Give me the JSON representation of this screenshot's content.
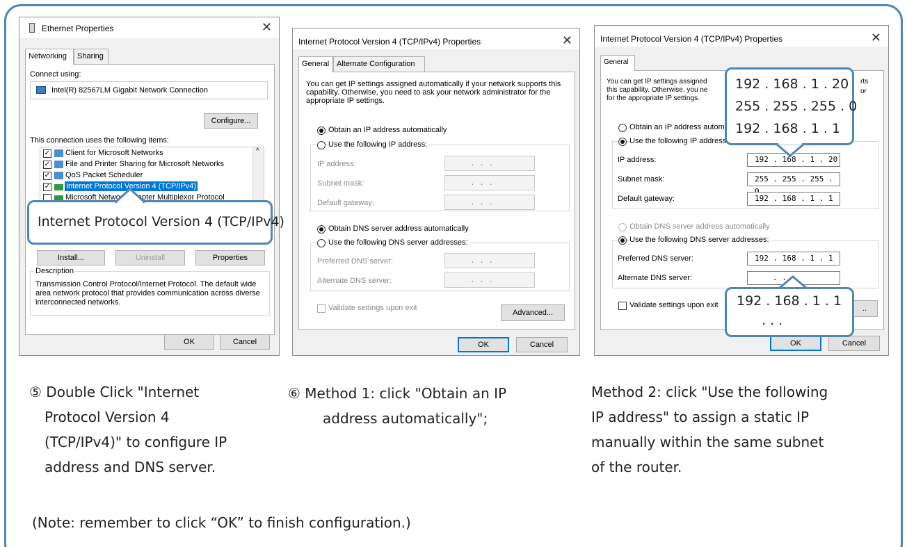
{
  "d1": {
    "title": "Ethernet Properties",
    "tabs": [
      "Networking",
      "Sharing"
    ],
    "connect_using_label": "Connect using:",
    "adapter": "Intel(R) 82567LM Gigabit Network Connection",
    "configure_btn": "Configure...",
    "items_label": "This connection uses the following items:",
    "items": [
      "Client for Microsoft Networks",
      "File and Printer Sharing for Microsoft Networks",
      "QoS Packet Scheduler",
      "Internet Protocol Version 4 (TCP/IPv4)",
      "Microsoft Network Adapter Multiplexor Protocol"
    ],
    "callout": "Internet Protocol Version 4 (TCP/IPv4)",
    "install_btn": "Install...",
    "uninstall_btn": "Uninstall",
    "properties_btn": "Properties",
    "description_label": "Description",
    "description": "Transmission Control Protocol/Internet Protocol. The default wide area network protocol that provides communication across diverse interconnected networks.",
    "ok": "OK",
    "cancel": "Cancel"
  },
  "d2": {
    "title": "Internet Protocol Version 4 (TCP/IPv4) Properties",
    "tabs": [
      "General",
      "Alternate Configuration"
    ],
    "intro": "You can get IP settings assigned automatically if your network supports this capability. Otherwise, you need to ask your network administrator for the appropriate IP settings.",
    "obtain_ip": "Obtain an IP address automatically",
    "use_ip": "Use the following IP address:",
    "ip_label": "IP address:",
    "mask_label": "Subnet mask:",
    "gw_label": "Default gateway:",
    "obtain_dns": "Obtain DNS server address automatically",
    "use_dns": "Use the following DNS server addresses:",
    "pref_dns_label": "Preferred DNS server:",
    "alt_dns_label": "Alternate DNS server:",
    "empty_ip": ".       .       .",
    "validate": "Validate settings upon exit",
    "advanced": "Advanced...",
    "ok": "OK",
    "cancel": "Cancel"
  },
  "d3": {
    "title": "Internet Protocol Version 4 (TCP/IPv4) Properties",
    "tabs": [
      "General"
    ],
    "intro_l1": "You can get IP settings assigned",
    "intro_l2": "this capability. Otherwise, you ne",
    "intro_l3": "for the appropriate IP settings.",
    "intro_r1": "rts",
    "intro_r2": "or",
    "obtain_ip": "Obtain an IP address autom",
    "use_ip": "Use the following IP address:",
    "ip_label": "IP address:",
    "ip_value": "192 . 168 .  1  . 20",
    "mask_label": "Subnet mask:",
    "mask_value": "255 . 255 . 255 .  0",
    "gw_label": "Default gateway:",
    "gw_value": "192 . 168 .  1  .  1",
    "obtain_dns": "Obtain DNS server address automatically",
    "use_dns": "Use the following DNS server addresses:",
    "pref_dns_label": "Preferred DNS server:",
    "pref_dns_value": "192 . 168 .  1  .  1",
    "alt_dns_label": "Alternate DNS server:",
    "alt_dns_value": ".      .      .",
    "validate": "Validate settings upon exit",
    "advanced_partial": "..",
    "ok": "OK",
    "cancel": "Cancel",
    "callout_top": [
      "192 . 168 .  1  . 20",
      "255 . 255 . 255 . 0",
      "192 . 168 .  1  . 1"
    ],
    "callout_bottom": [
      "192 . 168 .  1  . 1",
      ".        .        ."
    ]
  },
  "captions": {
    "c1_lines": [
      "⑤ Double Click \"Internet",
      "Protocol Version 4",
      "(TCP/IPv4)\" to configure IP",
      "address and DNS server."
    ],
    "c2_lines": [
      "⑥ Method 1: click \"Obtain an IP",
      "address automatically\";"
    ],
    "c3_lines": [
      "Method 2: click \"Use the following",
      "IP address\" to assign a static IP",
      "manually within the same subnet",
      "of the router."
    ],
    "note": "(Note: remember to click “OK” to finish configuration.)"
  },
  "colors": {
    "accent": "#4e86b5",
    "selection": "#0078d7",
    "dialog_bg": "#f0f0f0"
  }
}
